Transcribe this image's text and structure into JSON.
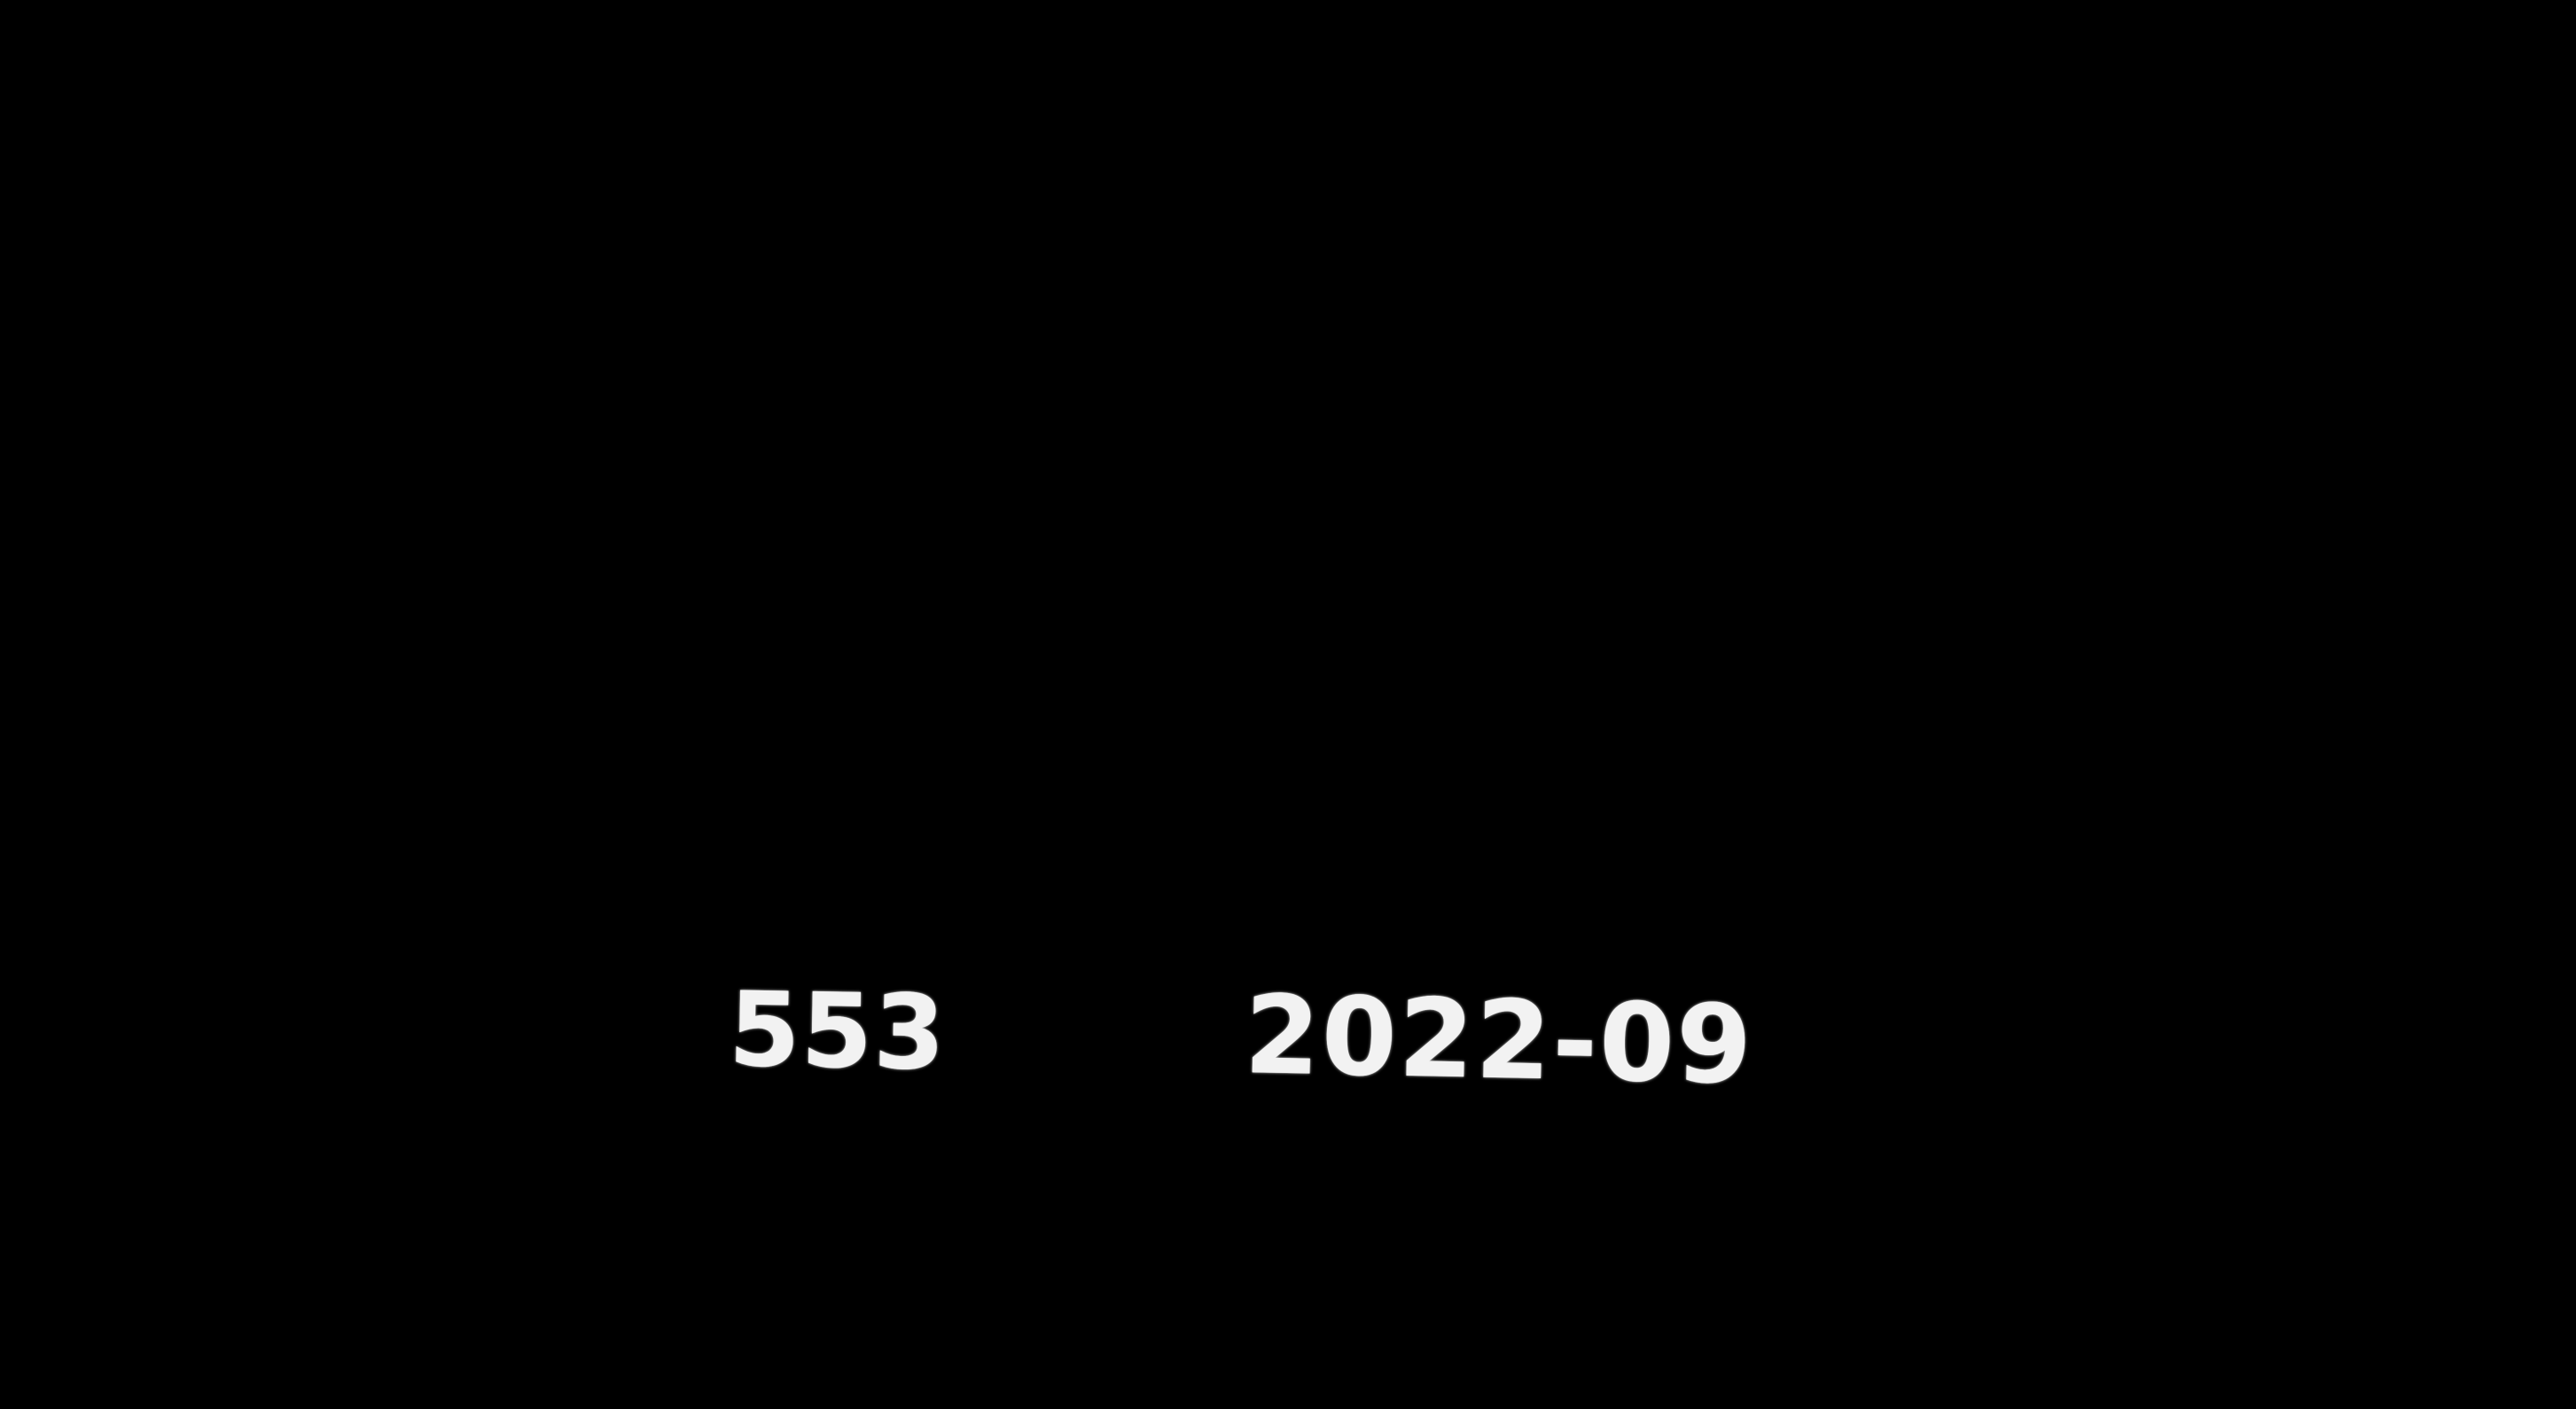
{
  "left_number": "553",
  "date_text": "2022-09",
  "colors": {
    "background": "#000000",
    "text": "#f2f2f2"
  }
}
